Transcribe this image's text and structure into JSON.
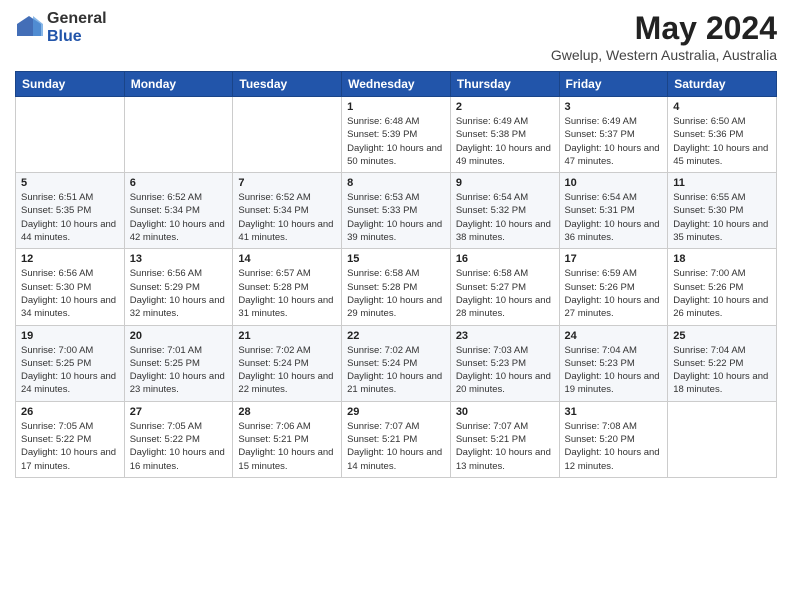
{
  "logo": {
    "general": "General",
    "blue": "Blue"
  },
  "header": {
    "title": "May 2024",
    "subtitle": "Gwelup, Western Australia, Australia"
  },
  "weekdays": [
    "Sunday",
    "Monday",
    "Tuesday",
    "Wednesday",
    "Thursday",
    "Friday",
    "Saturday"
  ],
  "weeks": [
    [
      {
        "day": "",
        "info": ""
      },
      {
        "day": "",
        "info": ""
      },
      {
        "day": "",
        "info": ""
      },
      {
        "day": "1",
        "info": "Sunrise: 6:48 AM\nSunset: 5:39 PM\nDaylight: 10 hours and 50 minutes."
      },
      {
        "day": "2",
        "info": "Sunrise: 6:49 AM\nSunset: 5:38 PM\nDaylight: 10 hours and 49 minutes."
      },
      {
        "day": "3",
        "info": "Sunrise: 6:49 AM\nSunset: 5:37 PM\nDaylight: 10 hours and 47 minutes."
      },
      {
        "day": "4",
        "info": "Sunrise: 6:50 AM\nSunset: 5:36 PM\nDaylight: 10 hours and 45 minutes."
      }
    ],
    [
      {
        "day": "5",
        "info": "Sunrise: 6:51 AM\nSunset: 5:35 PM\nDaylight: 10 hours and 44 minutes."
      },
      {
        "day": "6",
        "info": "Sunrise: 6:52 AM\nSunset: 5:34 PM\nDaylight: 10 hours and 42 minutes."
      },
      {
        "day": "7",
        "info": "Sunrise: 6:52 AM\nSunset: 5:34 PM\nDaylight: 10 hours and 41 minutes."
      },
      {
        "day": "8",
        "info": "Sunrise: 6:53 AM\nSunset: 5:33 PM\nDaylight: 10 hours and 39 minutes."
      },
      {
        "day": "9",
        "info": "Sunrise: 6:54 AM\nSunset: 5:32 PM\nDaylight: 10 hours and 38 minutes."
      },
      {
        "day": "10",
        "info": "Sunrise: 6:54 AM\nSunset: 5:31 PM\nDaylight: 10 hours and 36 minutes."
      },
      {
        "day": "11",
        "info": "Sunrise: 6:55 AM\nSunset: 5:30 PM\nDaylight: 10 hours and 35 minutes."
      }
    ],
    [
      {
        "day": "12",
        "info": "Sunrise: 6:56 AM\nSunset: 5:30 PM\nDaylight: 10 hours and 34 minutes."
      },
      {
        "day": "13",
        "info": "Sunrise: 6:56 AM\nSunset: 5:29 PM\nDaylight: 10 hours and 32 minutes."
      },
      {
        "day": "14",
        "info": "Sunrise: 6:57 AM\nSunset: 5:28 PM\nDaylight: 10 hours and 31 minutes."
      },
      {
        "day": "15",
        "info": "Sunrise: 6:58 AM\nSunset: 5:28 PM\nDaylight: 10 hours and 29 minutes."
      },
      {
        "day": "16",
        "info": "Sunrise: 6:58 AM\nSunset: 5:27 PM\nDaylight: 10 hours and 28 minutes."
      },
      {
        "day": "17",
        "info": "Sunrise: 6:59 AM\nSunset: 5:26 PM\nDaylight: 10 hours and 27 minutes."
      },
      {
        "day": "18",
        "info": "Sunrise: 7:00 AM\nSunset: 5:26 PM\nDaylight: 10 hours and 26 minutes."
      }
    ],
    [
      {
        "day": "19",
        "info": "Sunrise: 7:00 AM\nSunset: 5:25 PM\nDaylight: 10 hours and 24 minutes."
      },
      {
        "day": "20",
        "info": "Sunrise: 7:01 AM\nSunset: 5:25 PM\nDaylight: 10 hours and 23 minutes."
      },
      {
        "day": "21",
        "info": "Sunrise: 7:02 AM\nSunset: 5:24 PM\nDaylight: 10 hours and 22 minutes."
      },
      {
        "day": "22",
        "info": "Sunrise: 7:02 AM\nSunset: 5:24 PM\nDaylight: 10 hours and 21 minutes."
      },
      {
        "day": "23",
        "info": "Sunrise: 7:03 AM\nSunset: 5:23 PM\nDaylight: 10 hours and 20 minutes."
      },
      {
        "day": "24",
        "info": "Sunrise: 7:04 AM\nSunset: 5:23 PM\nDaylight: 10 hours and 19 minutes."
      },
      {
        "day": "25",
        "info": "Sunrise: 7:04 AM\nSunset: 5:22 PM\nDaylight: 10 hours and 18 minutes."
      }
    ],
    [
      {
        "day": "26",
        "info": "Sunrise: 7:05 AM\nSunset: 5:22 PM\nDaylight: 10 hours and 17 minutes."
      },
      {
        "day": "27",
        "info": "Sunrise: 7:05 AM\nSunset: 5:22 PM\nDaylight: 10 hours and 16 minutes."
      },
      {
        "day": "28",
        "info": "Sunrise: 7:06 AM\nSunset: 5:21 PM\nDaylight: 10 hours and 15 minutes."
      },
      {
        "day": "29",
        "info": "Sunrise: 7:07 AM\nSunset: 5:21 PM\nDaylight: 10 hours and 14 minutes."
      },
      {
        "day": "30",
        "info": "Sunrise: 7:07 AM\nSunset: 5:21 PM\nDaylight: 10 hours and 13 minutes."
      },
      {
        "day": "31",
        "info": "Sunrise: 7:08 AM\nSunset: 5:20 PM\nDaylight: 10 hours and 12 minutes."
      },
      {
        "day": "",
        "info": ""
      }
    ]
  ]
}
